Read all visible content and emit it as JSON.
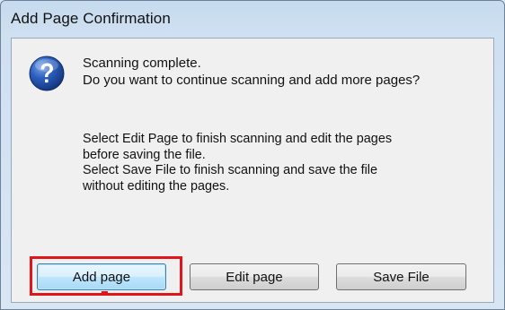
{
  "window": {
    "title": "Add Page Confirmation"
  },
  "message": {
    "line1": "Scanning complete.",
    "line2": "Do you want to continue scanning and add more pages?",
    "detail_line1": "Select Edit Page to finish scanning and edit the pages",
    "detail_line2": "before saving the file.",
    "detail_line3": "Select Save File to finish scanning and save the file",
    "detail_line4": "without editing the pages."
  },
  "buttons": {
    "add_page": "Add page",
    "edit_page": "Edit page",
    "save_file": "Save File"
  },
  "icons": {
    "question": "question-icon"
  },
  "colors": {
    "highlight": "#e0161b",
    "icon_blue": "#1f4fa8"
  }
}
